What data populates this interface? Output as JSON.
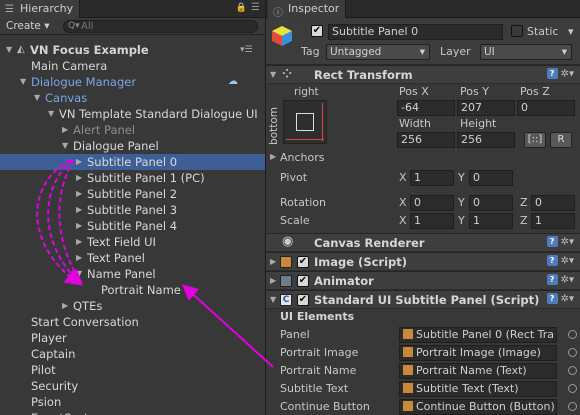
{
  "hierarchy": {
    "tab": "Hierarchy",
    "create": "Create",
    "search_placeholder": "All",
    "rows": [
      {
        "text": "VN Focus Example",
        "indent": 0,
        "expand": "open",
        "color": "scene"
      },
      {
        "text": "Main Camera",
        "indent": 1,
        "expand": "",
        "color": "w"
      },
      {
        "text": "Dialogue Manager",
        "indent": 1,
        "expand": "open",
        "color": "blue"
      },
      {
        "text": "Canvas",
        "indent": 2,
        "expand": "open",
        "color": "blue"
      },
      {
        "text": "VN Template Standard Dialogue UI",
        "indent": 3,
        "expand": "open",
        "color": "w"
      },
      {
        "text": "Alert Panel",
        "indent": 4,
        "expand": "closed",
        "color": "grey"
      },
      {
        "text": "Dialogue Panel",
        "indent": 4,
        "expand": "open",
        "color": "w"
      },
      {
        "text": "Subtitle Panel 0",
        "indent": 5,
        "expand": "closed",
        "color": "w",
        "selected": true
      },
      {
        "text": "Subtitle Panel 1 (PC)",
        "indent": 5,
        "expand": "closed",
        "color": "w"
      },
      {
        "text": "Subtitle Panel 2",
        "indent": 5,
        "expand": "closed",
        "color": "w"
      },
      {
        "text": "Subtitle Panel 3",
        "indent": 5,
        "expand": "closed",
        "color": "w"
      },
      {
        "text": "Subtitle Panel 4",
        "indent": 5,
        "expand": "closed",
        "color": "w"
      },
      {
        "text": "Text Field UI",
        "indent": 5,
        "expand": "closed",
        "color": "w"
      },
      {
        "text": "Text Panel",
        "indent": 5,
        "expand": "closed",
        "color": "w"
      },
      {
        "text": "Name Panel",
        "indent": 5,
        "expand": "open",
        "color": "w"
      },
      {
        "text": "Portrait Name",
        "indent": 6,
        "expand": "",
        "color": "w"
      },
      {
        "text": "QTEs",
        "indent": 4,
        "expand": "closed",
        "color": "w"
      },
      {
        "text": "Start Conversation",
        "indent": 1,
        "expand": "",
        "color": "w"
      },
      {
        "text": "Player",
        "indent": 1,
        "expand": "",
        "color": "w"
      },
      {
        "text": "Captain",
        "indent": 1,
        "expand": "",
        "color": "w"
      },
      {
        "text": "Pilot",
        "indent": 1,
        "expand": "",
        "color": "w"
      },
      {
        "text": "Security",
        "indent": 1,
        "expand": "",
        "color": "w"
      },
      {
        "text": "Psion",
        "indent": 1,
        "expand": "",
        "color": "w"
      },
      {
        "text": "EventSystem",
        "indent": 1,
        "expand": "",
        "color": "w"
      }
    ]
  },
  "inspector": {
    "tab": "Inspector",
    "object_name": "Subtitle Panel 0",
    "static": "Static",
    "tag_label": "Tag",
    "tag_value": "Untagged",
    "layer_label": "Layer",
    "layer_value": "UI",
    "rect_transform": {
      "title": "Rect Transform",
      "anchor_h": "right",
      "anchor_v": "bottom",
      "pos_x_label": "Pos X",
      "pos_y_label": "Pos Y",
      "pos_z_label": "Pos Z",
      "pos_x": "-64",
      "pos_y": "207",
      "pos_z": "0",
      "width_label": "Width",
      "height_label": "Height",
      "width": "256",
      "height": "256",
      "r_button": "R",
      "anchors": "Anchors",
      "pivot": "Pivot",
      "pivot_x": "1",
      "pivot_y": "0",
      "rotation": "Rotation",
      "rot_x": "0",
      "rot_y": "0",
      "rot_z": "0",
      "scale": "Scale",
      "scale_x": "1",
      "scale_y": "1",
      "scale_z": "1",
      "x": "X",
      "y": "Y",
      "z": "Z"
    },
    "canvas_renderer": "Canvas Renderer",
    "image_script": "Image (Script)",
    "animator": "Animator",
    "subtitle_script": "Standard UI Subtitle Panel (Script)",
    "ui_elements": "UI Elements",
    "fields": [
      {
        "label": "Panel",
        "value": "Subtitle Panel 0 (Rect Tra"
      },
      {
        "label": "Portrait Image",
        "value": "Portrait Image (Image)"
      },
      {
        "label": "Portrait Name",
        "value": "Portrait Name (Text)"
      },
      {
        "label": "Subtitle Text",
        "value": "Subtitle Text (Text)"
      },
      {
        "label": "Continue Button",
        "value": "Continue Button (Button)"
      }
    ]
  },
  "colors": {
    "selection": "#3e5f96",
    "arrow": "#e000e0",
    "blue_text": "#7aa6e8"
  }
}
